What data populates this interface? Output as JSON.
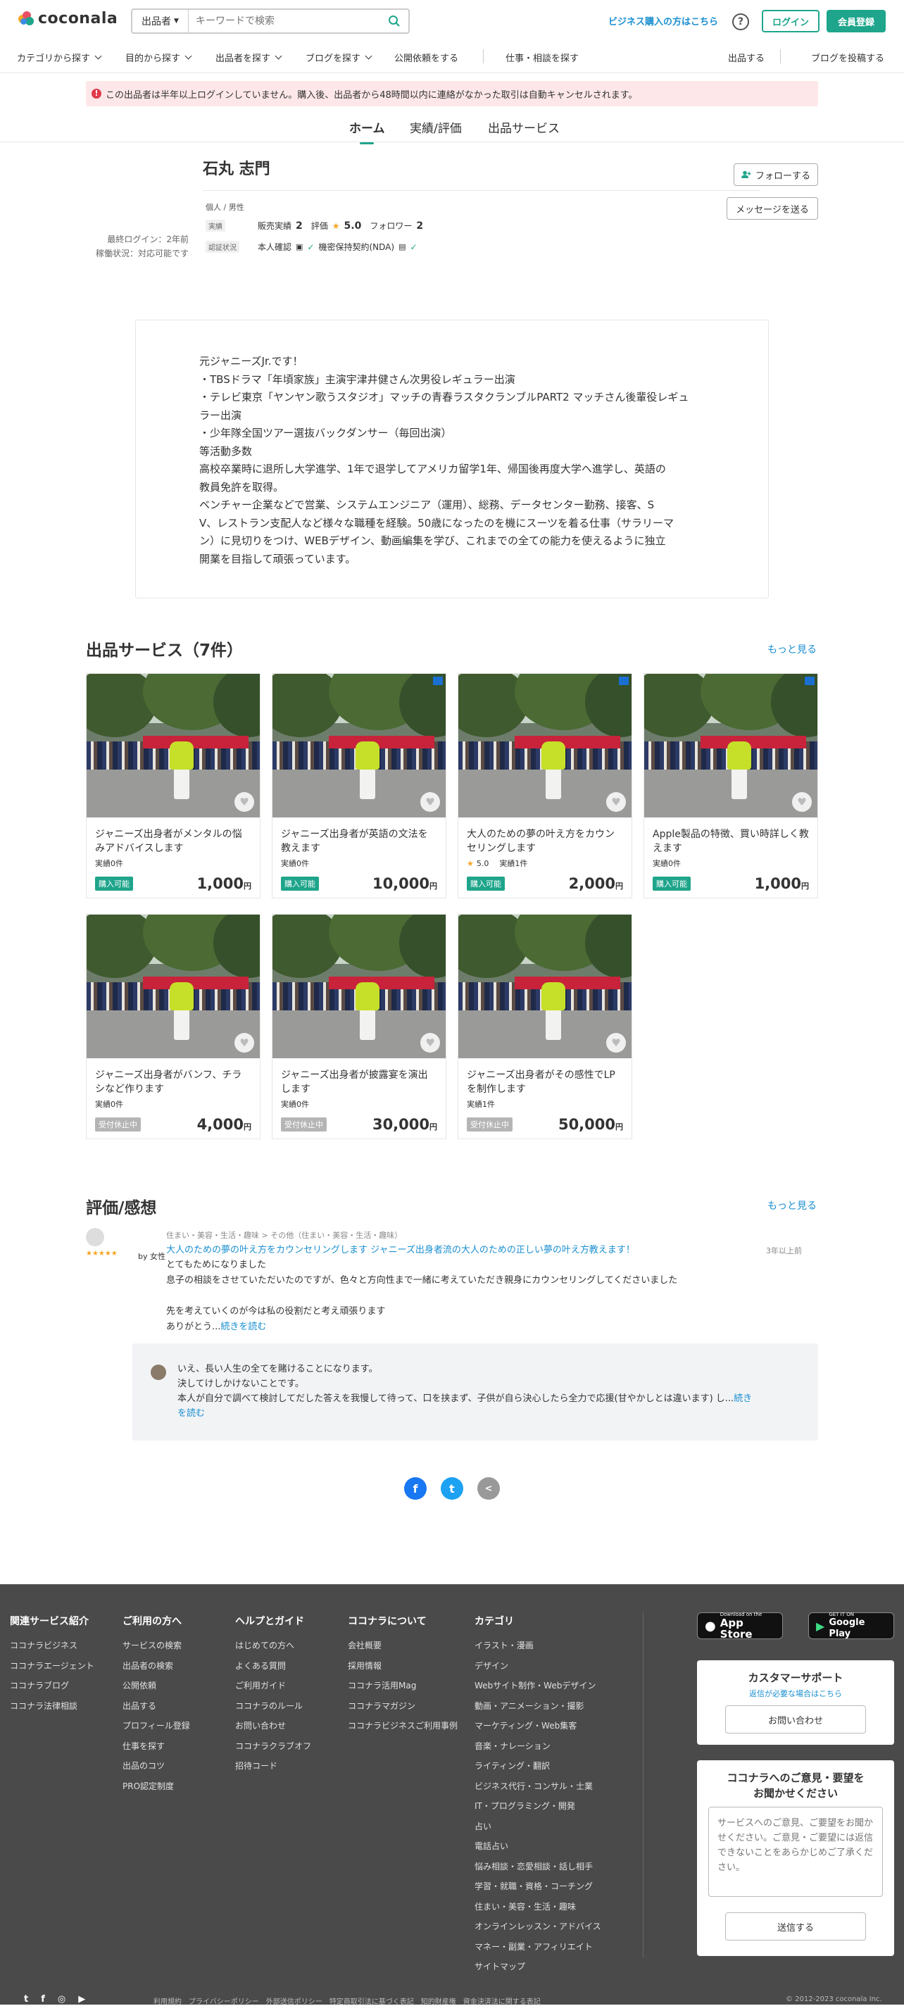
{
  "header": {
    "logo_text": "coconala",
    "search_category": "出品者",
    "search_placeholder": "キーワードで検索",
    "business_link": "ビジネス購入の方はこちら",
    "help_label": "?",
    "login_label": "ログイン",
    "register_label": "会員登録"
  },
  "nav": {
    "items": [
      "カテゴリから探す",
      "目的から探す",
      "出品者を探す",
      "ブログを探す"
    ],
    "request": "公開依頼をする",
    "work": "仕事・相談を探す",
    "sell": "出品する",
    "post_blog": "ブログを投稿する"
  },
  "alert": {
    "icon": "!",
    "text": "この出品者は半年以上ログインしていません。購入後、出品者から48時間以内に連絡がなかった取引は自動キャンセルされます。"
  },
  "tabs": [
    "ホーム",
    "実績/評価",
    "出品サービス"
  ],
  "profile": {
    "name": "石丸 志門",
    "follow_label": "フォローする",
    "message_label": "メッセージを送る",
    "attributes": "個人 / 男性",
    "results_tag": "実績",
    "sales_label": "販売実績",
    "sales_value": "2",
    "rating_label": "評価",
    "rating_value": "5.0",
    "followers_label": "フォロワー",
    "followers_value": "2",
    "verify_tag": "認証状況",
    "identity": "本人確認",
    "nda": "機密保持契約(NDA)",
    "last_login": "最終ログイン：2年前",
    "status": "稼働状況：対応可能です"
  },
  "intro": "元ジャニーズJr.です！\n・TBSドラマ「年頃家族」主演宇津井健さん次男役レギュラー出演\n・テレビ東京「ヤンヤン歌うスタジオ」マッチの青春ラスタクランブルPART2 マッチさん後輩役レギュ\nラー出演\n・少年隊全国ツアー選抜バックダンサー（毎回出演）\n等活動多数\n高校卒業時に退所し大学進学、1年で退学してアメリカ留学1年、帰国後再度大学へ進学し、英語の\n教員免許を取得。\nベンチャー企業などで営業、システムエンジニア（運用）、総務、データセンター勤務、接客、S\nV、レストラン支配人など様々な職種を経験。50歳になったのを機にスーツを着る仕事（サラリーマ\nン）に見切りをつけ、WEBデザイン、動画編集を学び、これまでの全ての能力を使えるように独立\n開業を目指して頑張っています。",
  "services": {
    "title": "出品サービス（7件）",
    "more": "もっと見る",
    "yen": "円",
    "items": [
      {
        "title": "ジャニーズ出身者がメンタルの悩みアドバイスします",
        "meta": "実績0件",
        "stars": "",
        "badge": "購入可能",
        "price": "1,000"
      },
      {
        "title": "ジャニーズ出身者が英語の文法を教えます",
        "meta": "実績0件",
        "stars": "",
        "badge": "購入可能",
        "price": "10,000"
      },
      {
        "title": "大人のための夢の叶え方をカウンセリングします",
        "meta": "実績1件",
        "stars": "5.0",
        "badge": "購入可能",
        "price": "2,000"
      },
      {
        "title": "Apple製品の特徴、買い時詳しく教えます",
        "meta": "実績0件",
        "stars": "",
        "badge": "購入可能",
        "price": "1,000"
      },
      {
        "title": "ジャニーズ出身者がバンフ、チラシなど作ります",
        "meta": "実績0件",
        "stars": "",
        "badge": "受付休止中",
        "price": "4,000"
      },
      {
        "title": "ジャニーズ出身者が披露宴を演出します",
        "meta": "実績0件",
        "stars": "",
        "badge": "受付休止中",
        "price": "30,000"
      },
      {
        "title": "ジャニーズ出身者がその感性でLPを制作します",
        "meta": "実績1件",
        "stars": "",
        "badge": "受付休止中",
        "price": "50,000"
      }
    ]
  },
  "reviews": {
    "title": "評価/感想",
    "more": "もっと見る",
    "category": "住まい・美容・生活・趣味 > その他（住まい・美容・生活・趣味）",
    "link": "大人のための夢の叶え方をカウンセリングします ジャニーズ出身者流の大人のための正しい夢の叶え方教えます！",
    "stars": "★★★★★",
    "by": "by 女性",
    "date": "3年以上前",
    "body": "とてもためになりました\n息子の相談をさせていただいたのですが、色々と方向性まで一緒に考えていただき親身にカウンセリングしてくださいました\n\n先を考えていくのが今は私の役割だと考え頑張ります\nありがとう...",
    "read_more": "続きを読む",
    "reply": "いえ、長い人生の全てを賭けることになります。\n決してけしかけないことです。\n本人が自分で調べて検討してだした答えを我慢して待って、口を挟まず、子供が自ら決心したら全力で応援(甘やかしとは違います) し...",
    "reply_more": "続き\nを読む"
  },
  "share": {
    "facebook": "f",
    "twitter": "t",
    "other": "<"
  },
  "footer": {
    "cols": [
      {
        "title": "関連サービス紹介",
        "items": [
          "ココナラビジネス",
          "ココナラエージェント",
          "ココナラブログ",
          "ココナラ法律相談"
        ]
      },
      {
        "title": "ご利用の方へ",
        "items": [
          "サービスの検索",
          "出品者の検索",
          "公開依頼",
          "出品する",
          "プロフィール登録",
          "仕事を探す",
          "出品のコツ",
          "PRO認定制度"
        ]
      },
      {
        "title": "ヘルプとガイド",
        "items": [
          "はじめての方へ",
          "よくある質問",
          "ご利用ガイド",
          "ココナラのルール",
          "お問い合わせ",
          "ココナラクラブオフ",
          "招待コード"
        ]
      },
      {
        "title": "ココナラについて",
        "items": [
          "会社概要",
          "採用情報",
          "ココナラ活用Mag",
          "ココナラマガジン",
          "ココナラビジネスご利用事例"
        ]
      },
      {
        "title": "カテゴリ",
        "items": [
          "イラスト・漫画",
          "デザイン",
          "Webサイト制作・Webデザイン",
          "動画・アニメーション・撮影",
          "マーケティング・Web集客",
          "音楽・ナレーション",
          "ライティング・翻訳",
          "ビジネス代行・コンサル・士業",
          "IT・プログラミング・開発",
          "占い",
          "電話占い",
          "悩み相談・恋愛相談・話し相手",
          "学習・就職・資格・コーチング",
          "住まい・美容・生活・趣味",
          "オンラインレッスン・アドバイス",
          "マネー・副業・アフィリエイト",
          "サイトマップ"
        ]
      }
    ],
    "appstore_small": "Download on the",
    "appstore_large": "App Store",
    "gplay_small": "GET IT ON",
    "gplay_large": "Google Play",
    "support_title": "カスタマーサポート",
    "support_sub": "返信が必要な場合はこちら",
    "support_btn": "お問い合わせ",
    "feedback_title": "ココナラへのご意見・要望を\nお聞かせください",
    "feedback_placeholder": "サービスへのご意見、ご要望をお聞かせください。ご意見・ご要望には返信できないことをあらかじめご了承ください。",
    "send_btn": "送信する",
    "bottom_links": "利用規約　プライバシーポリシー　外部送信ポリシー　特定商取引法に基づく表記　知的財産権　資金決済法に関する表記　",
    "copyright": "© 2012-2023 coconala Inc."
  },
  "colors": {
    "accent": "#1ea58b",
    "link": "#1a8fd1",
    "alert_bg": "#fde7e9",
    "footer_bg": "#4a4a4a",
    "badge_off": "#b5b5b5"
  }
}
